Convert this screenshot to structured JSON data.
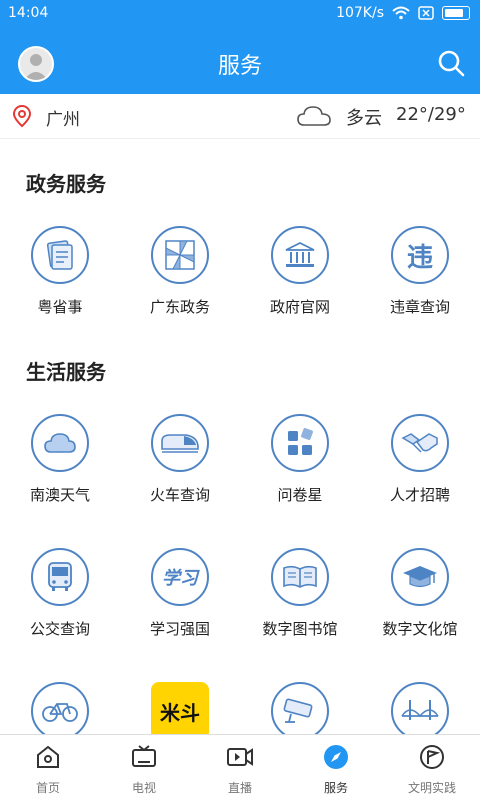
{
  "status": {
    "time": "14:04",
    "speed": "107K/s"
  },
  "header": {
    "title": "服务"
  },
  "location": {
    "city": "广州",
    "weather": "多云",
    "temp": "22°/29°"
  },
  "sections": {
    "gov": {
      "title": "政务服务",
      "items": [
        "粤省事",
        "广东政务",
        "政府官网",
        "违章查询"
      ]
    },
    "life": {
      "title": "生活服务",
      "items": [
        "南澳天气",
        "火车查询",
        "问卷星",
        "人才招聘",
        "公交查询",
        "学习强国",
        "数字图书馆",
        "数字文化馆"
      ]
    }
  },
  "icons": {
    "gov": [
      "document-stack-icon",
      "pinwheel-icon",
      "government-building-icon",
      "violation-char-icon"
    ],
    "life": [
      "cloud-icon",
      "train-icon",
      "grid-app-icon",
      "handshake-icon",
      "bus-icon",
      "study-logo-icon",
      "open-book-icon",
      "graduation-cap-icon"
    ],
    "partial": [
      "bicycle-icon",
      "mi-app-icon",
      "camera-icon",
      "bridge-icon"
    ]
  },
  "partial_tile_text": "米斗",
  "nav": [
    {
      "label": "首页",
      "icon": "home-icon"
    },
    {
      "label": "电视",
      "icon": "tv-icon"
    },
    {
      "label": "直播",
      "icon": "live-video-icon"
    },
    {
      "label": "服务",
      "icon": "compass-icon"
    },
    {
      "label": "文明实践",
      "icon": "flag-icon"
    }
  ],
  "colors": {
    "primary": "#2196F3",
    "icon_stroke": "#4f84c4",
    "accent_yellow": "#FFD400"
  }
}
